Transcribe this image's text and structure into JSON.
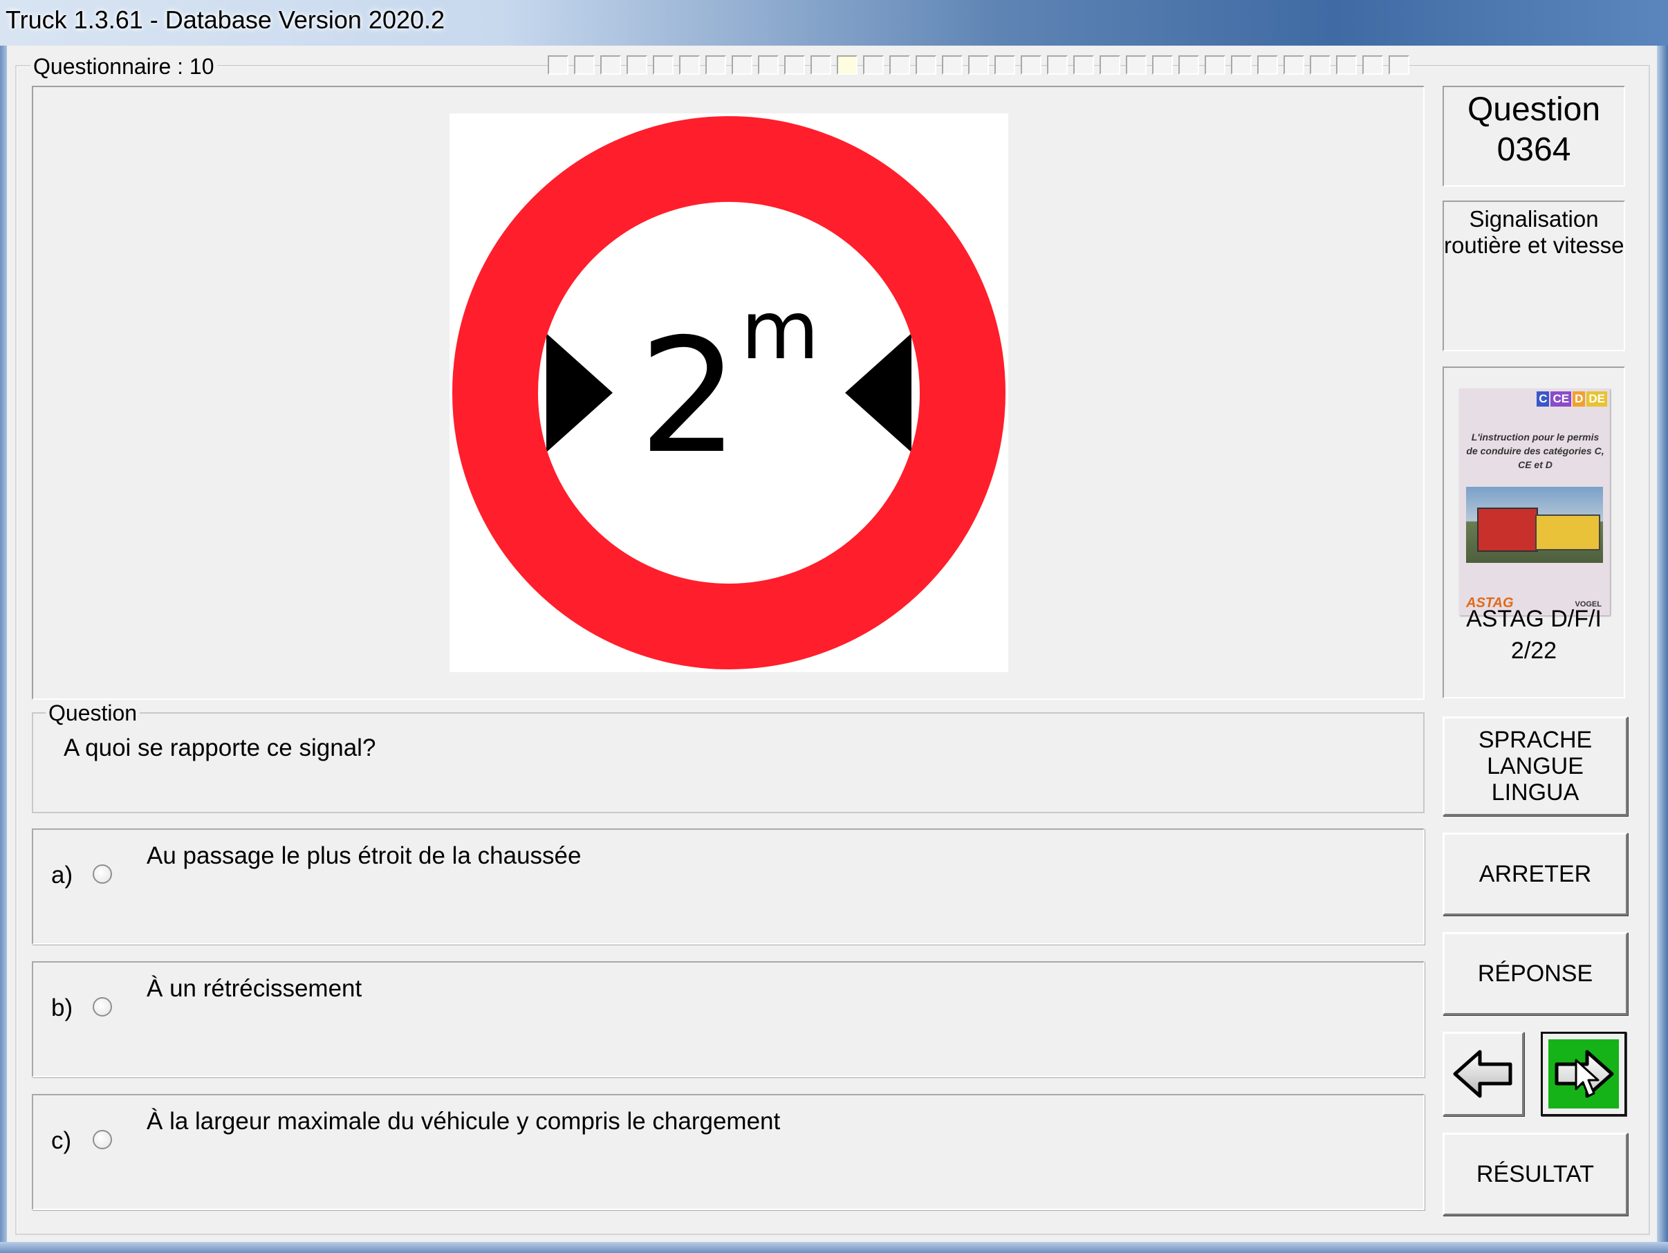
{
  "window": {
    "title": "Truck 1.3.61 - Database Version 2020.2"
  },
  "questionnaire": {
    "label": "Questionnaire : 10",
    "progress_total": 33,
    "progress_active_index": 11
  },
  "sign": {
    "type": "maximum-width-sign",
    "number": "2",
    "unit": "m",
    "ring_color": "#ff1e2b"
  },
  "question": {
    "label": "Question",
    "text": "A quoi se rapporte ce signal?",
    "number_line1": "Question",
    "number_line2": "0364",
    "category_line1": "Signalisation",
    "category_line2": "routière et vitesse"
  },
  "answers": [
    {
      "letter": "a)",
      "text": "Au passage le plus étroit de la chaussée"
    },
    {
      "letter": "b)",
      "text": "À un rétrécissement"
    },
    {
      "letter": "c)",
      "text": "À la largeur maximale du véhicule y compris le chargement"
    }
  ],
  "book": {
    "categories": [
      "C",
      "CE",
      "D",
      "DE"
    ],
    "category_colors": [
      "#3b57c9",
      "#8a4cc8",
      "#f0a12e",
      "#e7c330"
    ],
    "cover_text": "L'instruction pour le permis de conduire des catégories C, CE et D",
    "publisher_left": "ASTAG",
    "publisher_right": "VOGEL",
    "caption_line1": "ASTAG D/F/I",
    "caption_line2": "2/22"
  },
  "buttons": {
    "language_line1": "SPRACHE",
    "language_line2": "LANGUE",
    "language_line3": "LINGUA",
    "stop": "ARRETER",
    "response": "RÉPONSE",
    "result": "RÉSULTAT",
    "prev_icon": "arrow-left-icon",
    "next_icon": "arrow-right-icon",
    "next_color": "#16b318"
  }
}
